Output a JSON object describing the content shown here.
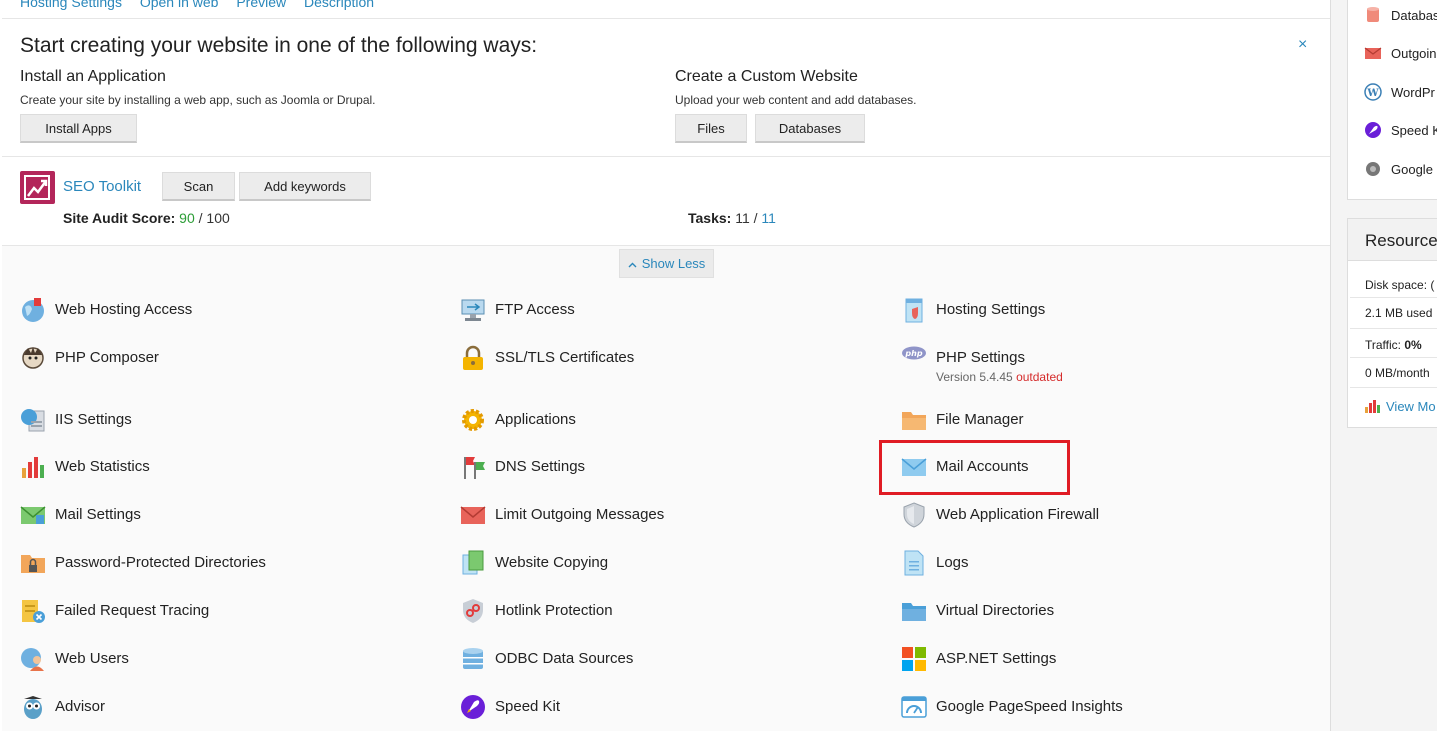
{
  "top_links": [
    "Hosting Settings",
    "Open in web",
    "Preview",
    "Description"
  ],
  "start": {
    "title": "Start creating your website in one of the following ways:",
    "close": "×",
    "install": {
      "title": "Install an Application",
      "desc": "Create your site by installing a web app, such as Joomla or Drupal.",
      "button": "Install Apps"
    },
    "custom": {
      "title": "Create a Custom Website",
      "desc": "Upload your web content and add databases.",
      "files_button": "Files",
      "databases_button": "Databases"
    }
  },
  "seo": {
    "link": "SEO Toolkit",
    "scan_button": "Scan",
    "keywords_button": "Add keywords",
    "audit_label": "Site Audit Score:",
    "audit_score": "90",
    "audit_total": "/ 100",
    "tasks_label": "Tasks:",
    "tasks_done": "11 /",
    "tasks_total": "11"
  },
  "show_less": "Show Less",
  "tools": {
    "c1": [
      "Web Hosting Access",
      "PHP Composer",
      "IIS Settings",
      "Web Statistics",
      "Mail Settings",
      "Password-Protected Directories",
      "Failed Request Tracing",
      "Web Users",
      "Advisor"
    ],
    "c2": [
      "FTP Access",
      "SSL/TLS Certificates",
      "Applications",
      "DNS Settings",
      "Limit Outgoing Messages",
      "Website Copying",
      "Hotlink Protection",
      "ODBC Data Sources",
      "Speed Kit"
    ],
    "c3": [
      "Hosting Settings",
      "PHP Settings",
      "File Manager",
      "Mail Accounts",
      "Web Application Firewall",
      "Logs",
      "Virtual Directories",
      "ASP.NET Settings",
      "Google PageSpeed Insights"
    ],
    "php_version": "Version 5.4.45",
    "php_status": "outdated"
  },
  "sidebar": {
    "items": [
      "Databas",
      "Outgoin",
      "WordPr",
      "Speed K",
      "Google"
    ],
    "resources_title": "Resource",
    "disk_label": "Disk space: (",
    "disk_used": "2.1 MB used",
    "traffic_label": "Traffic:",
    "traffic_value": "0%",
    "traffic_month": "0 MB/month",
    "view_more": "View Mo"
  },
  "colors": {
    "accent": "#2a87bb",
    "good": "#2c9d37",
    "bad": "#d52b2b",
    "highlight": "#e01c24"
  }
}
